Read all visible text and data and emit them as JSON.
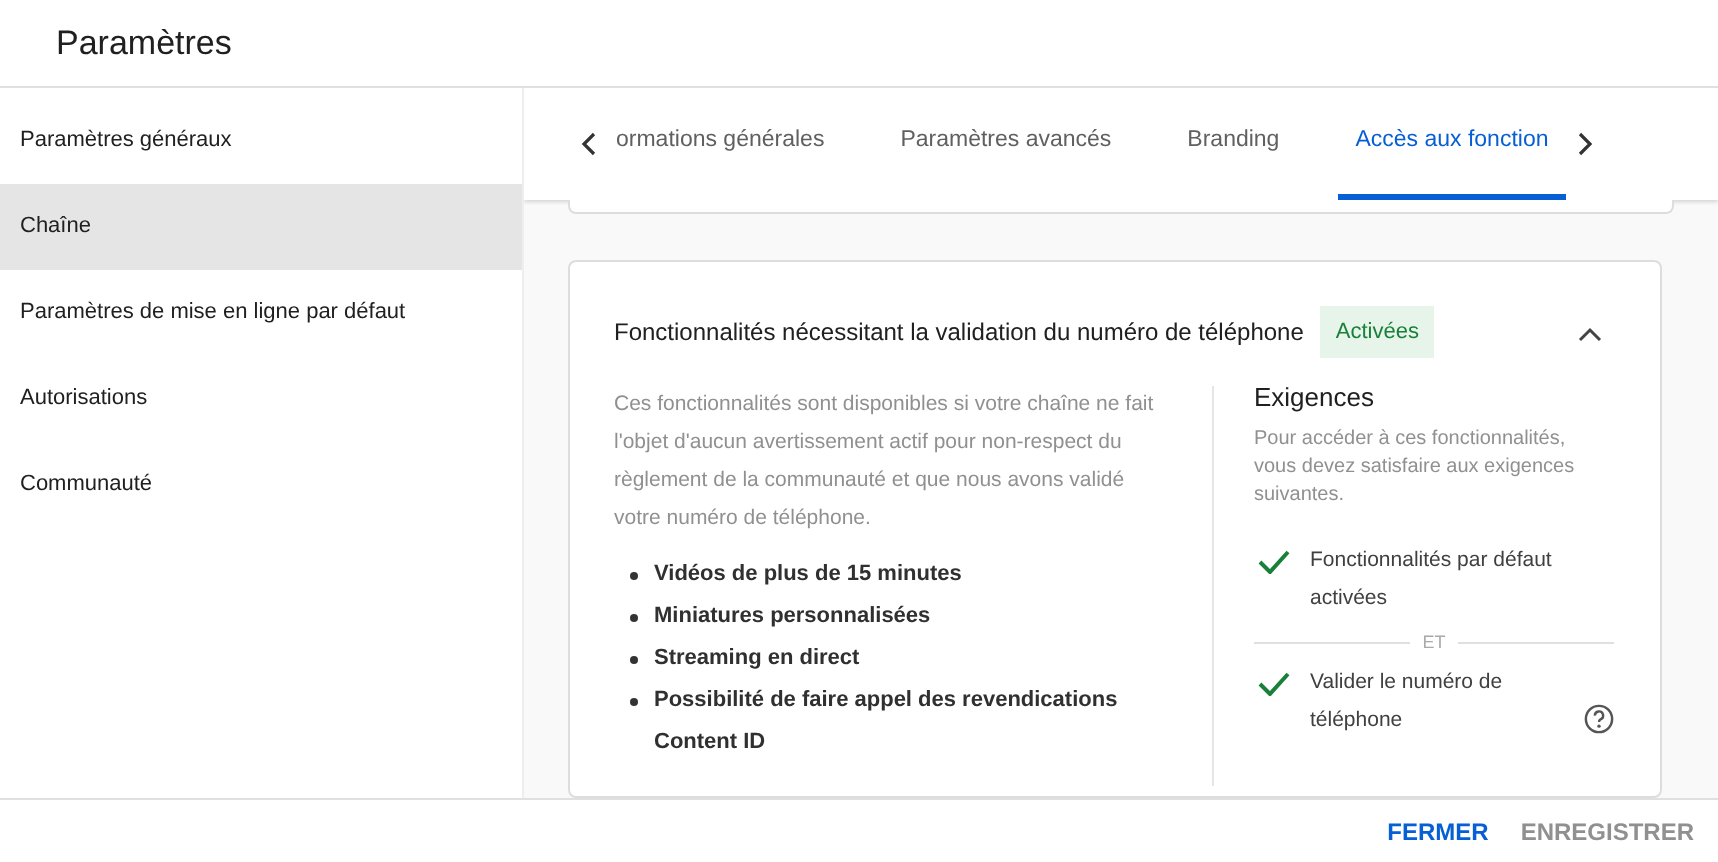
{
  "page_title": "Paramètres",
  "sidebar": {
    "items": [
      {
        "label": "Paramètres généraux",
        "selected": false
      },
      {
        "label": "Chaîne",
        "selected": true
      },
      {
        "label": "Paramètres de mise en ligne par défaut",
        "selected": false
      },
      {
        "label": "Autorisations",
        "selected": false
      },
      {
        "label": "Communauté",
        "selected": false
      }
    ]
  },
  "tabs": [
    {
      "label": "ormations générales",
      "selected": false
    },
    {
      "label": "Paramètres avancés",
      "selected": false
    },
    {
      "label": "Branding",
      "selected": false
    },
    {
      "label": "Accès aux fonction",
      "selected": true
    }
  ],
  "section": {
    "title": "Fonctionnalités nécessitant la validation du numéro de téléphone",
    "status": "Activées",
    "expanded": true,
    "description": "Ces fonctionnalités sont disponibles si votre chaîne ne fait l'objet d'aucun avertissement actif pour non-respect du règlement de la communauté et que nous avons validé votre numéro de téléphone.",
    "features": [
      "Vidéos de plus de 15 minutes",
      "Miniatures personnalisées",
      "Streaming en direct",
      "Possibilité de faire appel des revendications Content ID"
    ],
    "requirements_title": "Exigences",
    "requirements_text": "Pour accéder à ces fonctionnalités, vous devez satisfaire aux exigences suivantes.",
    "requirements": [
      {
        "label": "Fonctionnalités par défaut activées",
        "done": true,
        "help": false
      },
      {
        "label": "Valider le numéro de téléphone",
        "done": true,
        "help": true
      }
    ],
    "separator": "ET"
  },
  "buttons": [
    {
      "label": "FERMER",
      "disabled": false
    },
    {
      "label": "ENREGISTRER",
      "disabled": true
    }
  ]
}
